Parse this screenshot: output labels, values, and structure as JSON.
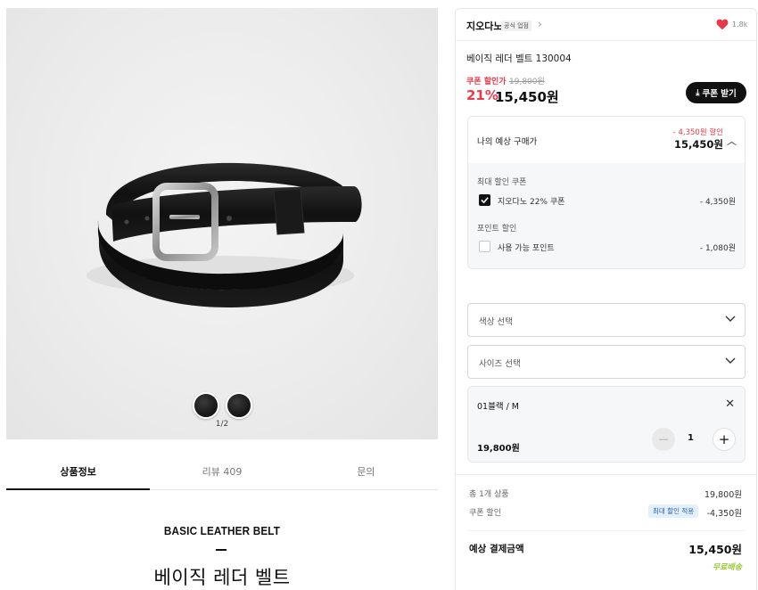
{
  "gallery": {
    "counter": "1/2",
    "swatches": [
      "black-1",
      "black-2"
    ]
  },
  "tabs": [
    {
      "label": "상품정보",
      "active": true
    },
    {
      "label": "리뷰 409",
      "active": false
    },
    {
      "label": "문의",
      "active": false
    }
  ],
  "detail": {
    "english_title": "BASIC LEATHER BELT",
    "korean_title": "베이직 레더 벨트"
  },
  "brand": {
    "name": "지오다노",
    "badge": "공식 업점",
    "likes": "1.8k",
    "heart_color": "#e8394b"
  },
  "product": {
    "name": "베이직 레더 벨트 130004",
    "coupon_label": "쿠폰 할인가",
    "original_price": "19,800원",
    "discount_rate": "21%",
    "sale_price": "15,450원",
    "coupon_button": "쿠폰 받기",
    "accent_color": "#f0384a"
  },
  "estimate": {
    "label": "나의 예상 구매가",
    "discount": "- 4,350원 할인",
    "price": "15,450원",
    "coupon_section": "최대 할인 쿠폰",
    "coupon_option": {
      "label": "지오다노 22% 쿠폰",
      "value": "- 4,350원",
      "checked": true
    },
    "point_section": "포인트 할인",
    "point_option": {
      "label": "사용 가능 포인트",
      "value": "- 1,080원",
      "checked": false
    }
  },
  "options": {
    "color_placeholder": "색상 선택",
    "size_placeholder": "사이즈 선택"
  },
  "selected_item": {
    "name": "01블랙 / M",
    "price": "19,800원",
    "quantity": "1"
  },
  "summary": {
    "total_items_label": "총 1개 상품",
    "total_items_value": "19,800원",
    "coupon_discount_label": "쿠폰 할인",
    "max_discount_badge": "최대 할인 적용",
    "coupon_discount_value": "-4,350원",
    "final_label": "예상 결제금액",
    "final_value": "15,450원",
    "shipping": "무료배송"
  }
}
